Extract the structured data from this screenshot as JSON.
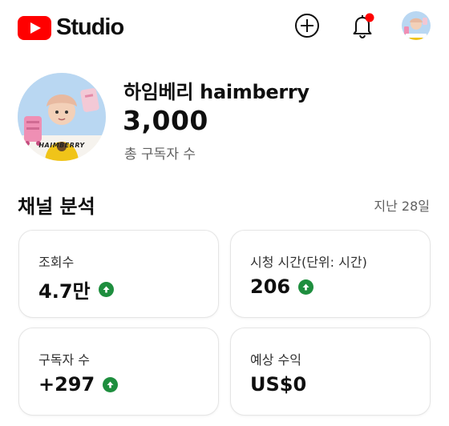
{
  "header": {
    "logo_text": "Studio",
    "logo_color": "#ff0000",
    "icons": [
      "create-icon",
      "notification-bell-icon",
      "account-avatar"
    ],
    "notification_dot_color": "#ff0000"
  },
  "channel": {
    "avatar_caption": "HAIMBERRY",
    "name": "하임베리 haimberry",
    "subscribers": "3,000",
    "subscribers_label": "총 구독자 수"
  },
  "analytics": {
    "title": "채널 분석",
    "period": "지난 28일",
    "trend_up_color": "#1e8e3e",
    "cards": [
      {
        "label": "조회수",
        "value": "4.7만",
        "trend": "up"
      },
      {
        "label": "시청 시간(단위: 시간)",
        "value": "206",
        "trend": "up"
      },
      {
        "label": "구독자 수",
        "value": "+297",
        "trend": "up"
      },
      {
        "label": "예상 수익",
        "value": "US$0",
        "trend": "none"
      }
    ]
  }
}
